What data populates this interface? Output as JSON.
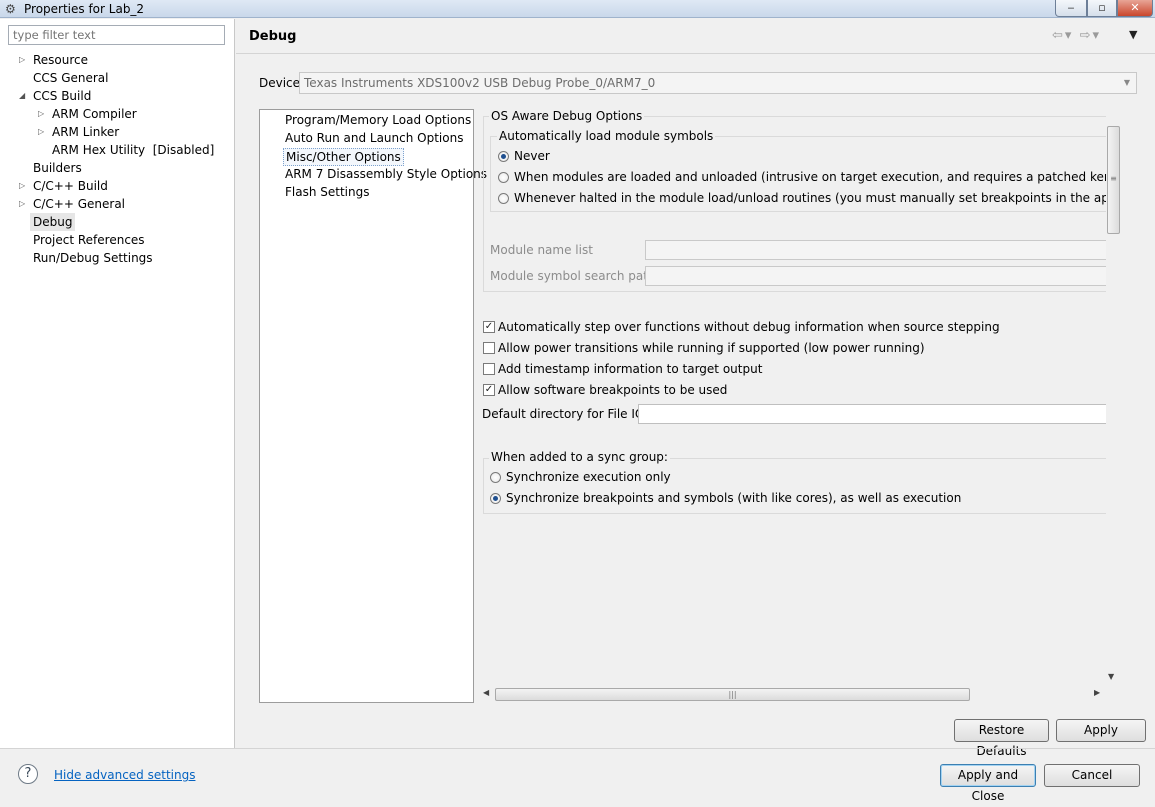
{
  "window": {
    "title": "Properties for Lab_2",
    "minimize": "‒",
    "maximize": "▫",
    "close": "✕"
  },
  "filter": {
    "placeholder": "type filter text"
  },
  "tree": [
    {
      "label": "Resource",
      "expandable": true,
      "level": 0
    },
    {
      "label": "CCS General",
      "expandable": false,
      "level": 0
    },
    {
      "label": "CCS Build",
      "expanded": true,
      "level": 0
    },
    {
      "label": "ARM Compiler",
      "expandable": true,
      "level": 1
    },
    {
      "label": "ARM Linker",
      "expandable": true,
      "level": 1
    },
    {
      "label": "ARM Hex Utility  [Disabled]",
      "expandable": false,
      "level": 1
    },
    {
      "label": "Builders",
      "expandable": false,
      "level": 0
    },
    {
      "label": "C/C++ Build",
      "expandable": true,
      "level": 0
    },
    {
      "label": "C/C++ General",
      "expandable": true,
      "level": 0
    },
    {
      "label": "Debug",
      "selected": true,
      "level": 0
    },
    {
      "label": "Project References",
      "level": 0
    },
    {
      "label": "Run/Debug Settings",
      "level": 0
    }
  ],
  "main": {
    "title": "Debug",
    "device_label": "Device",
    "device_value": "Texas Instruments XDS100v2 USB Debug Probe_0/ARM7_0"
  },
  "options": [
    "Program/Memory Load Options",
    "Auto Run and Launch Options",
    "Misc/Other Options",
    "ARM 7 Disassembly Style Options",
    "Flash Settings"
  ],
  "os_aware": {
    "title": "OS Aware Debug Options",
    "sub_title": "Automatically load module symbols",
    "radios": [
      {
        "label": "Never",
        "checked": true
      },
      {
        "label": "When modules are loaded and unloaded (intrusive on target execution, and requires a patched kernel)",
        "checked": false
      },
      {
        "label": "Whenever halted in the module load/unload routines (you must manually set breakpoints in the appropriate rou",
        "checked": false
      }
    ],
    "module_name_list": "Module name list",
    "module_symbol_path": "Module symbol search path"
  },
  "checkboxes": [
    {
      "label": "Automatically step over functions without debug information when source stepping",
      "checked": true
    },
    {
      "label": "Allow power transitions while running if supported (low power running)",
      "checked": false
    },
    {
      "label": "Add timestamp information to target output",
      "checked": false
    },
    {
      "label": "Allow software breakpoints to be used",
      "checked": true
    }
  ],
  "file_io_label": "Default directory for File IO:",
  "sync_group": {
    "title": "When added to a sync group:",
    "radios": [
      {
        "label": "Synchronize execution only",
        "checked": false
      },
      {
        "label": "Synchronize breakpoints and symbols (with like cores), as well as execution",
        "checked": true
      }
    ]
  },
  "buttons": {
    "restore_defaults": "Restore Defaults",
    "apply": "Apply",
    "apply_and_close": "Apply and Close",
    "cancel": "Cancel"
  },
  "footer": {
    "help": "?",
    "hide_advanced": "Hide advanced settings"
  },
  "scroll": {
    "grip": "≡",
    "hgrip": "|||"
  }
}
